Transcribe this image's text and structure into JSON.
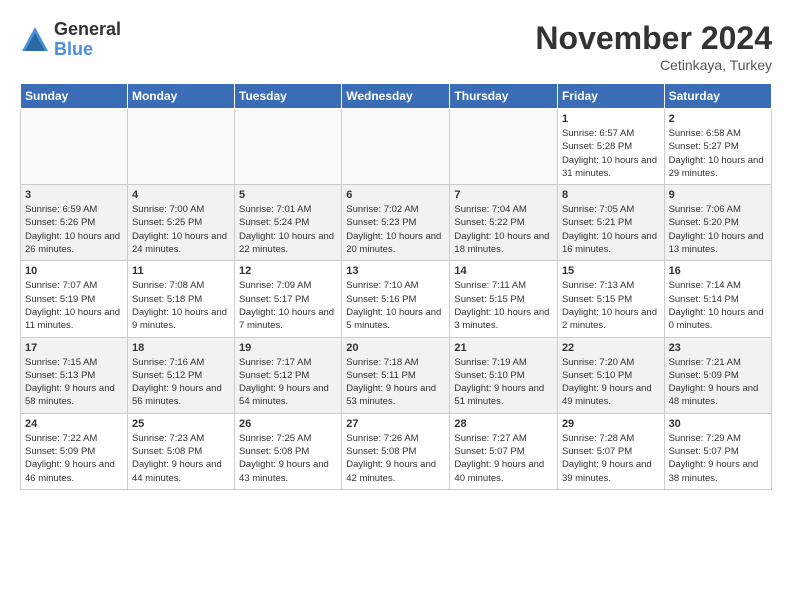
{
  "header": {
    "logo": {
      "general": "General",
      "blue": "Blue"
    },
    "month": "November 2024",
    "location": "Cetinkaya, Turkey"
  },
  "weekdays": [
    "Sunday",
    "Monday",
    "Tuesday",
    "Wednesday",
    "Thursday",
    "Friday",
    "Saturday"
  ],
  "weeks": [
    [
      {
        "day": "",
        "info": ""
      },
      {
        "day": "",
        "info": ""
      },
      {
        "day": "",
        "info": ""
      },
      {
        "day": "",
        "info": ""
      },
      {
        "day": "",
        "info": ""
      },
      {
        "day": "1",
        "info": "Sunrise: 6:57 AM\nSunset: 5:28 PM\nDaylight: 10 hours and 31 minutes."
      },
      {
        "day": "2",
        "info": "Sunrise: 6:58 AM\nSunset: 5:27 PM\nDaylight: 10 hours and 29 minutes."
      }
    ],
    [
      {
        "day": "3",
        "info": "Sunrise: 6:59 AM\nSunset: 5:26 PM\nDaylight: 10 hours and 26 minutes."
      },
      {
        "day": "4",
        "info": "Sunrise: 7:00 AM\nSunset: 5:25 PM\nDaylight: 10 hours and 24 minutes."
      },
      {
        "day": "5",
        "info": "Sunrise: 7:01 AM\nSunset: 5:24 PM\nDaylight: 10 hours and 22 minutes."
      },
      {
        "day": "6",
        "info": "Sunrise: 7:02 AM\nSunset: 5:23 PM\nDaylight: 10 hours and 20 minutes."
      },
      {
        "day": "7",
        "info": "Sunrise: 7:04 AM\nSunset: 5:22 PM\nDaylight: 10 hours and 18 minutes."
      },
      {
        "day": "8",
        "info": "Sunrise: 7:05 AM\nSunset: 5:21 PM\nDaylight: 10 hours and 16 minutes."
      },
      {
        "day": "9",
        "info": "Sunrise: 7:06 AM\nSunset: 5:20 PM\nDaylight: 10 hours and 13 minutes."
      }
    ],
    [
      {
        "day": "10",
        "info": "Sunrise: 7:07 AM\nSunset: 5:19 PM\nDaylight: 10 hours and 11 minutes."
      },
      {
        "day": "11",
        "info": "Sunrise: 7:08 AM\nSunset: 5:18 PM\nDaylight: 10 hours and 9 minutes."
      },
      {
        "day": "12",
        "info": "Sunrise: 7:09 AM\nSunset: 5:17 PM\nDaylight: 10 hours and 7 minutes."
      },
      {
        "day": "13",
        "info": "Sunrise: 7:10 AM\nSunset: 5:16 PM\nDaylight: 10 hours and 5 minutes."
      },
      {
        "day": "14",
        "info": "Sunrise: 7:11 AM\nSunset: 5:15 PM\nDaylight: 10 hours and 3 minutes."
      },
      {
        "day": "15",
        "info": "Sunrise: 7:13 AM\nSunset: 5:15 PM\nDaylight: 10 hours and 2 minutes."
      },
      {
        "day": "16",
        "info": "Sunrise: 7:14 AM\nSunset: 5:14 PM\nDaylight: 10 hours and 0 minutes."
      }
    ],
    [
      {
        "day": "17",
        "info": "Sunrise: 7:15 AM\nSunset: 5:13 PM\nDaylight: 9 hours and 58 minutes."
      },
      {
        "day": "18",
        "info": "Sunrise: 7:16 AM\nSunset: 5:12 PM\nDaylight: 9 hours and 56 minutes."
      },
      {
        "day": "19",
        "info": "Sunrise: 7:17 AM\nSunset: 5:12 PM\nDaylight: 9 hours and 54 minutes."
      },
      {
        "day": "20",
        "info": "Sunrise: 7:18 AM\nSunset: 5:11 PM\nDaylight: 9 hours and 53 minutes."
      },
      {
        "day": "21",
        "info": "Sunrise: 7:19 AM\nSunset: 5:10 PM\nDaylight: 9 hours and 51 minutes."
      },
      {
        "day": "22",
        "info": "Sunrise: 7:20 AM\nSunset: 5:10 PM\nDaylight: 9 hours and 49 minutes."
      },
      {
        "day": "23",
        "info": "Sunrise: 7:21 AM\nSunset: 5:09 PM\nDaylight: 9 hours and 48 minutes."
      }
    ],
    [
      {
        "day": "24",
        "info": "Sunrise: 7:22 AM\nSunset: 5:09 PM\nDaylight: 9 hours and 46 minutes."
      },
      {
        "day": "25",
        "info": "Sunrise: 7:23 AM\nSunset: 5:08 PM\nDaylight: 9 hours and 44 minutes."
      },
      {
        "day": "26",
        "info": "Sunrise: 7:25 AM\nSunset: 5:08 PM\nDaylight: 9 hours and 43 minutes."
      },
      {
        "day": "27",
        "info": "Sunrise: 7:26 AM\nSunset: 5:08 PM\nDaylight: 9 hours and 42 minutes."
      },
      {
        "day": "28",
        "info": "Sunrise: 7:27 AM\nSunset: 5:07 PM\nDaylight: 9 hours and 40 minutes."
      },
      {
        "day": "29",
        "info": "Sunrise: 7:28 AM\nSunset: 5:07 PM\nDaylight: 9 hours and 39 minutes."
      },
      {
        "day": "30",
        "info": "Sunrise: 7:29 AM\nSunset: 5:07 PM\nDaylight: 9 hours and 38 minutes."
      }
    ]
  ]
}
